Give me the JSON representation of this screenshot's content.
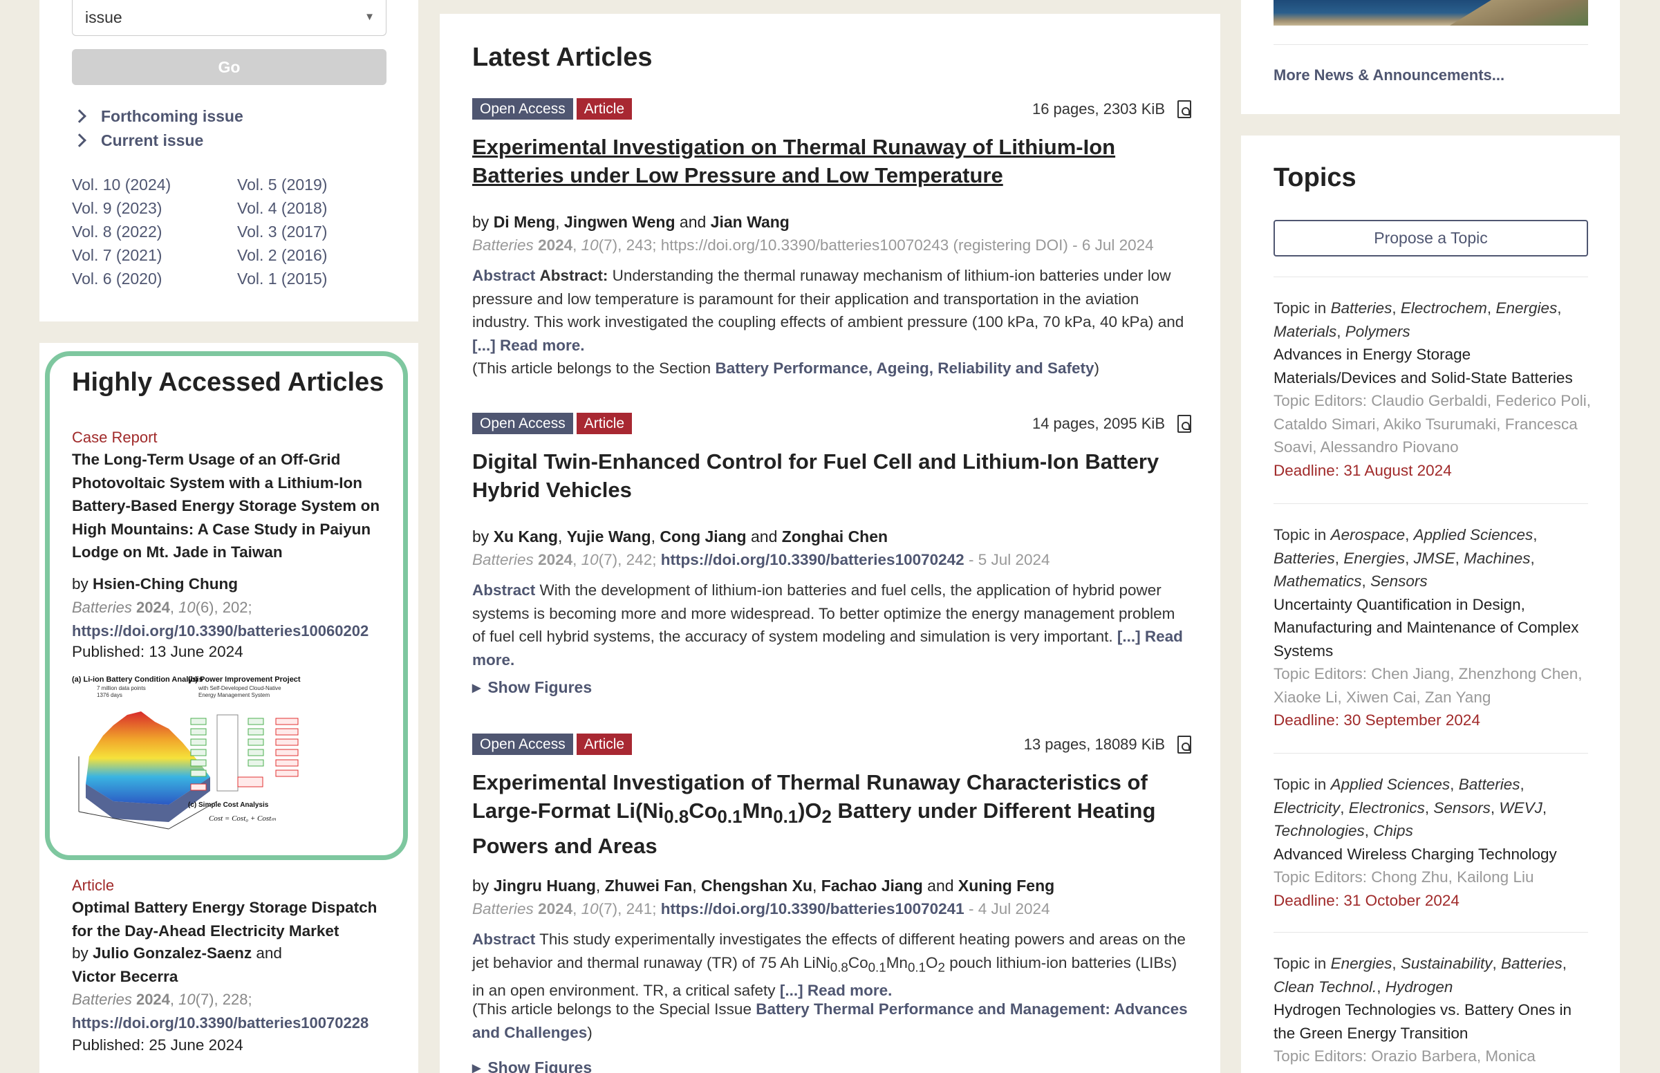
{
  "left": {
    "issue_select": {
      "value": "issue"
    },
    "go_label": "Go",
    "links": {
      "forthcoming": "Forthcoming issue",
      "current": "Current issue"
    },
    "volumes_left": [
      "Vol. 10 (2024)",
      "Vol. 9 (2023)",
      "Vol. 8 (2022)",
      "Vol. 7 (2021)",
      "Vol. 6 (2020)"
    ],
    "volumes_right": [
      "Vol. 5 (2019)",
      "Vol. 4 (2018)",
      "Vol. 3 (2017)",
      "Vol. 2 (2016)",
      "Vol. 1 (2015)"
    ]
  },
  "highly_accessed": {
    "title": "Highly Accessed Articles",
    "cards": [
      {
        "type": "Case Report",
        "title": "The Long-Term Usage of an Off-Grid Photovoltaic System with a Lithium-Ion Battery-Based Energy Storage System on High Mountains: A Case Study in Paiyun Lodge on Mt. Jade in Taiwan",
        "by": "by",
        "authors": "Hsien-Ching Chung",
        "journal": "Batteries",
        "year": "2024",
        "volume": "10",
        "issue_page": "(6), 202;",
        "doi": "https://doi.org/10.3390/batteries10060202",
        "published": "Published: 13 June 2024",
        "graphic": {
          "label_a": "(a) Li-ion Battery Condition Analysis",
          "label_a_sub1": "7 million data points",
          "label_a_sub2": "1376 days",
          "label_b": "(b) Power Improvement Project",
          "label_b_sub1": "with Self-Developed Cloud-Native",
          "label_b_sub2": "Energy Management System",
          "label_c": "(c) Simple Cost Analysis",
          "formula": "Cost = Cost₀ + Costₘ"
        }
      },
      {
        "type": "Article",
        "title": "Optimal Battery Energy Storage Dispatch for the Day-Ahead Electricity Market",
        "by": "by",
        "author1": "Julio Gonzalez-Saenz",
        "and": "and",
        "author2": "Victor Becerra",
        "journal": "Batteries",
        "year": "2024",
        "volume": "10",
        "issue_page": "(7), 228;",
        "doi": "https://doi.org/10.3390/batteries10070228",
        "published": "Published: 25 June 2024"
      }
    ]
  },
  "main": {
    "title": "Latest Articles",
    "badge_oa": "Open Access",
    "badge_article": "Article",
    "abstract_label": "Abstract",
    "read_more": "[...] Read more.",
    "show_figures": "Show Figures",
    "articles": [
      {
        "meta": "16 pages, 2303 KiB",
        "title": "Experimental Investigation on Thermal Runaway of Lithium-Ion Batteries under Low Pressure and Low Temperature",
        "authors": [
          "Di Meng",
          "Jingwen Weng",
          "Jian Wang"
        ],
        "journal": "Batteries",
        "year": "2024",
        "volume": "10",
        "issue_page": "(7), 243;",
        "doi": "https://doi.org/10.3390/batteries10070243 (registering DOI)",
        "date": "- 6 Jul 2024",
        "abstract_prefix": "Abstract:",
        "abstract": "Understanding the thermal runaway mechanism of lithium-ion batteries under low pressure and low temperature is paramount for their application and transportation in the aviation industry. This work investigated the coupling effects of ambient pressure (100 kPa, 70 kPa, 40 kPa) and",
        "section_prefix": "(This article belongs to the Section",
        "section": "Battery Performance, Ageing, Reliability and Safety",
        "section_suffix": ")"
      },
      {
        "meta": "14 pages, 2095 KiB",
        "title": "Digital Twin-Enhanced Control for Fuel Cell and Lithium-Ion Battery Hybrid Vehicles",
        "authors": [
          "Xu Kang",
          "Yujie Wang",
          "Cong Jiang",
          "Zonghai Chen"
        ],
        "journal": "Batteries",
        "year": "2024",
        "volume": "10",
        "issue_page": "(7), 242;",
        "doi": "https://doi.org/10.3390/batteries10070242",
        "date": "- 5 Jul 2024",
        "abstract": "With the development of lithium-ion batteries and fuel cells, the application of hybrid power systems is becoming more and more widespread. To better optimize the energy management problem of fuel cell hybrid systems, the accuracy of system modeling and simulation is very important."
      },
      {
        "meta": "13 pages, 18089 KiB",
        "title_html_parts": [
          "Experimental Investigation of Thermal Runaway Characteristics of Large-Format Li(Ni",
          "0.8",
          "Co",
          "0.1",
          "Mn",
          "0.1",
          ")O",
          "2",
          " Battery under Different Heating Powers and Areas"
        ],
        "authors": [
          "Jingru Huang",
          "Zhuwei Fan",
          "Chengshan Xu",
          "Fachao Jiang",
          "Xuning Feng"
        ],
        "journal": "Batteries",
        "year": "2024",
        "volume": "10",
        "issue_page": "(7), 241;",
        "doi": "https://doi.org/10.3390/batteries10070241",
        "date": "- 4 Jul 2024",
        "abstract_parts": [
          "This study experimentally investigates the effects of different heating powers and areas on the jet behavior and thermal runaway (TR) of 75 Ah LiNi",
          "0.8",
          "Co",
          "0.1",
          "Mn",
          "0.1",
          "O",
          "2",
          " pouch lithium-ion batteries (LIBs) in an open environment. TR, a critical safety"
        ],
        "section_prefix": "(This article belongs to the Special Issue",
        "section": "Battery Thermal Performance and Management: Advances and Challenges",
        "section_suffix": ")"
      }
    ]
  },
  "right": {
    "more_news": "More News & Announcements...",
    "topics_title": "Topics",
    "propose": "Propose a Topic",
    "topic_prefix": "Topic in",
    "topics": [
      {
        "journals": [
          "Batteries",
          "Electrochem",
          "Energies",
          "Materials",
          "Polymers"
        ],
        "title": "Advances in Energy Storage Materials/Devices and Solid-State Batteries",
        "editors": "Topic Editors: Claudio Gerbaldi, Federico Poli, Cataldo Simari, Akiko Tsurumaki, Francesca Soavi, Alessandro Piovano",
        "deadline": "Deadline: 31 August 2024"
      },
      {
        "journals": [
          "Aerospace",
          "Applied Sciences",
          "Batteries",
          "Energies",
          "JMSE",
          "Machines",
          "Mathematics",
          "Sensors"
        ],
        "title": "Uncertainty Quantification in Design, Manufacturing and Maintenance of Complex Systems",
        "editors": "Topic Editors: Chen Jiang, Zhenzhong Chen, Xiaoke Li, Xiwen Cai, Zan Yang",
        "deadline": "Deadline: 30 September 2024"
      },
      {
        "journals": [
          "Applied Sciences",
          "Batteries",
          "Electricity",
          "Electronics",
          "Sensors",
          "WEVJ",
          "Technologies",
          "Chips"
        ],
        "title": "Advanced Wireless Charging Technology",
        "editors": "Topic Editors: Chong Zhu, Kailong Liu",
        "deadline": "Deadline: 31 October 2024"
      },
      {
        "journals": [
          "Energies",
          "Sustainability",
          "Batteries",
          "Clean Technol.",
          "Hydrogen"
        ],
        "title": "Hydrogen Technologies vs. Battery Ones in the Green Energy Transition",
        "editors": "Topic Editors: Orazio Barbera, Monica"
      }
    ]
  },
  "colors": {
    "accent": "#4f5671",
    "red": "#a02a2a",
    "badge_red": "#a82832",
    "highlight_border": "#7ec79f",
    "page_bg": "#efece2"
  }
}
